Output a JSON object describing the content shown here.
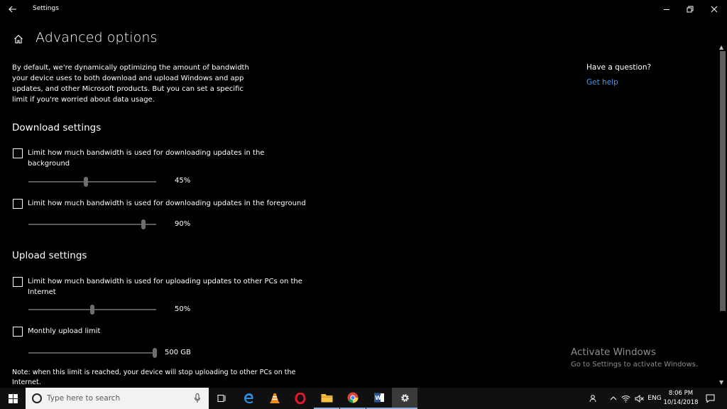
{
  "window": {
    "title": "Settings"
  },
  "page": {
    "title": "Advanced options",
    "intro": "By default, we're dynamically optimizing the amount of bandwidth your device uses to both download and upload Windows and app updates, and other Microsoft products. But you can set a specific limit if you're worried about data usage."
  },
  "download": {
    "heading": "Download settings",
    "background": {
      "label": "Limit how much bandwidth is used for downloading updates in the background",
      "checked": false,
      "value": 45,
      "value_label": "45%"
    },
    "foreground": {
      "label": "Limit how much bandwidth is used for downloading updates in the foreground",
      "checked": false,
      "value": 90,
      "value_label": "90%"
    }
  },
  "upload": {
    "heading": "Upload settings",
    "bandwidth": {
      "label": "Limit how much bandwidth is used for uploading updates to other PCs on the Internet",
      "checked": false,
      "value": 50,
      "value_label": "50%"
    },
    "monthly": {
      "label": "Monthly upload limit",
      "checked": false,
      "value_fraction": 1.0,
      "value_label": "500 GB"
    },
    "note": "Note: when this limit is reached, your device will stop uploading to other PCs on the Internet."
  },
  "help": {
    "heading": "Have a question?",
    "link": "Get help"
  },
  "watermark": {
    "title": "Activate Windows",
    "subtitle": "Go to Settings to activate Windows."
  },
  "taskbar": {
    "search_placeholder": "Type here to search",
    "language": "ENG",
    "time": "8:06 PM",
    "date": "10/14/2018"
  },
  "colors": {
    "background": "#000000",
    "accent": "#3f9ae8",
    "taskbar": "#101010"
  }
}
